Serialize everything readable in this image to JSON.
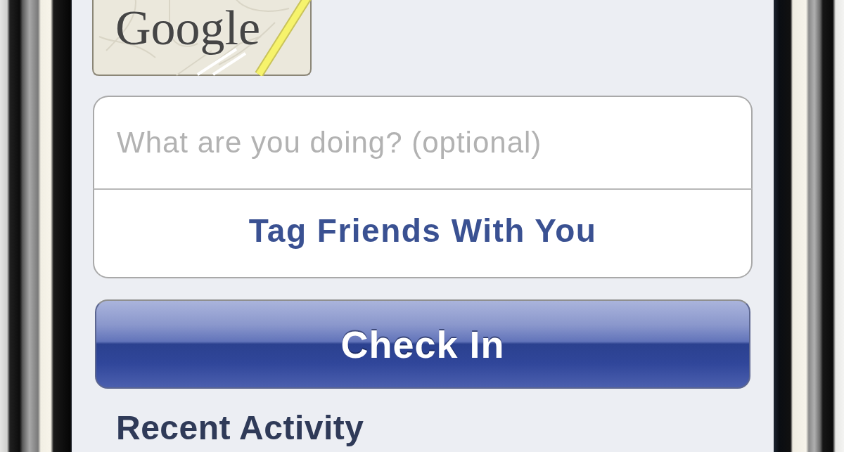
{
  "map": {
    "attribution": "Google"
  },
  "check_in_form": {
    "status_field": {
      "placeholder": "What are you doing? (optional)"
    },
    "tag_button": {
      "label": "Tag Friends With You"
    }
  },
  "check_in_button": {
    "label": "Check In"
  },
  "recent_activity": {
    "heading": "Recent Activity"
  }
}
